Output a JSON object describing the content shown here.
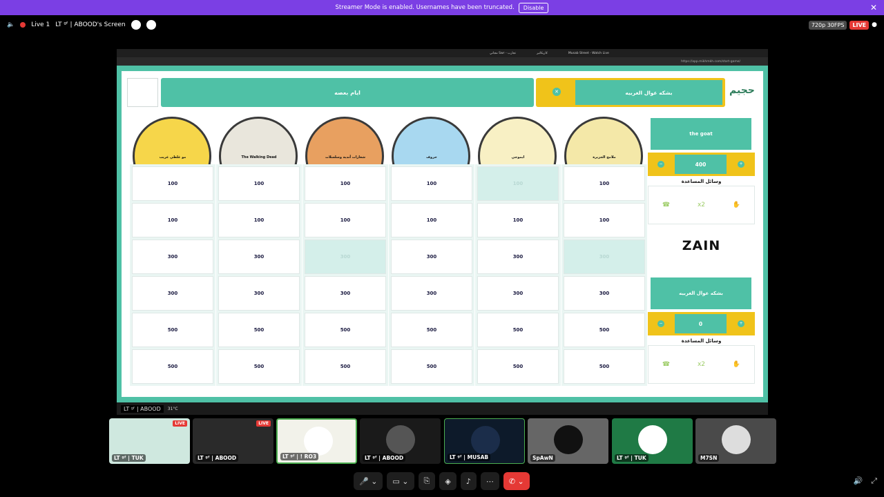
{
  "banner": {
    "text": "Streamer Mode is enabled. Usernames have been truncated.",
    "disable": "Disable",
    "close": "✕"
  },
  "stream": {
    "live_label": "Live 1",
    "title": "LT ᵍᶠ | ABOOD's Screen",
    "quality": "720p 30FPS",
    "live": "LIVE"
  },
  "browser": {
    "tabs": [
      "Musab Street - Watch Live",
      "كاريكاتير",
      "مجاني Swr - تجارب"
    ],
    "url": "https://app.mikhmkh.com/start-game/"
  },
  "game": {
    "top_banner": "ايام بعصه",
    "current_team": "بشكه عوال الغربيه",
    "logo": "حجيم",
    "categories": [
      "مو غلطي غريب",
      "The Walking Dead",
      "شعارات أندية وسلسلات",
      "حروف",
      "ايموجي",
      "ملامح الجزيرة"
    ],
    "rows": [
      [
        "100",
        "100",
        "100",
        "100",
        "100",
        "100"
      ],
      [
        "100",
        "100",
        "100",
        "100",
        "100",
        "100"
      ],
      [
        "300",
        "300",
        "300",
        "300",
        "300",
        "300"
      ],
      [
        "300",
        "300",
        "300",
        "300",
        "300",
        "300"
      ],
      [
        "500",
        "500",
        "500",
        "500",
        "500",
        "500"
      ],
      [
        "500",
        "500",
        "500",
        "500",
        "500",
        "500"
      ]
    ],
    "teams": [
      {
        "name": "the goat",
        "score": "400",
        "helpers_label": "وسائل المساعدة",
        "x2": "x2"
      },
      {
        "name": "بشكه عوال الغربيه",
        "score": "0",
        "helpers_label": "وسائل المساعدة",
        "x2": "x2"
      }
    ],
    "sponsor": "ZAIN"
  },
  "taskbar": {
    "user": "LT ᵍᶠ | ABOOD",
    "weather": "31°C"
  },
  "participants": [
    {
      "name": "LT ᵍᶠ | TUK",
      "live": "LIVE"
    },
    {
      "name": "LT ᵍᶠ | ABOOD",
      "live": "LIVE"
    },
    {
      "name": "LT ᵍᶠ | ! RO3"
    },
    {
      "name": "LT ᵍᶠ | ABOOD"
    },
    {
      "name": "LT ᵍᶠ | MUSAB"
    },
    {
      "name": "SpAwN"
    },
    {
      "name": "LT ᵍᶠ | TUK"
    },
    {
      "name": "M7SN"
    }
  ],
  "colors": {
    "accent": "#4fc1a6",
    "gold": "#f0c31a",
    "streamer_banner": "#7b3fe4"
  }
}
